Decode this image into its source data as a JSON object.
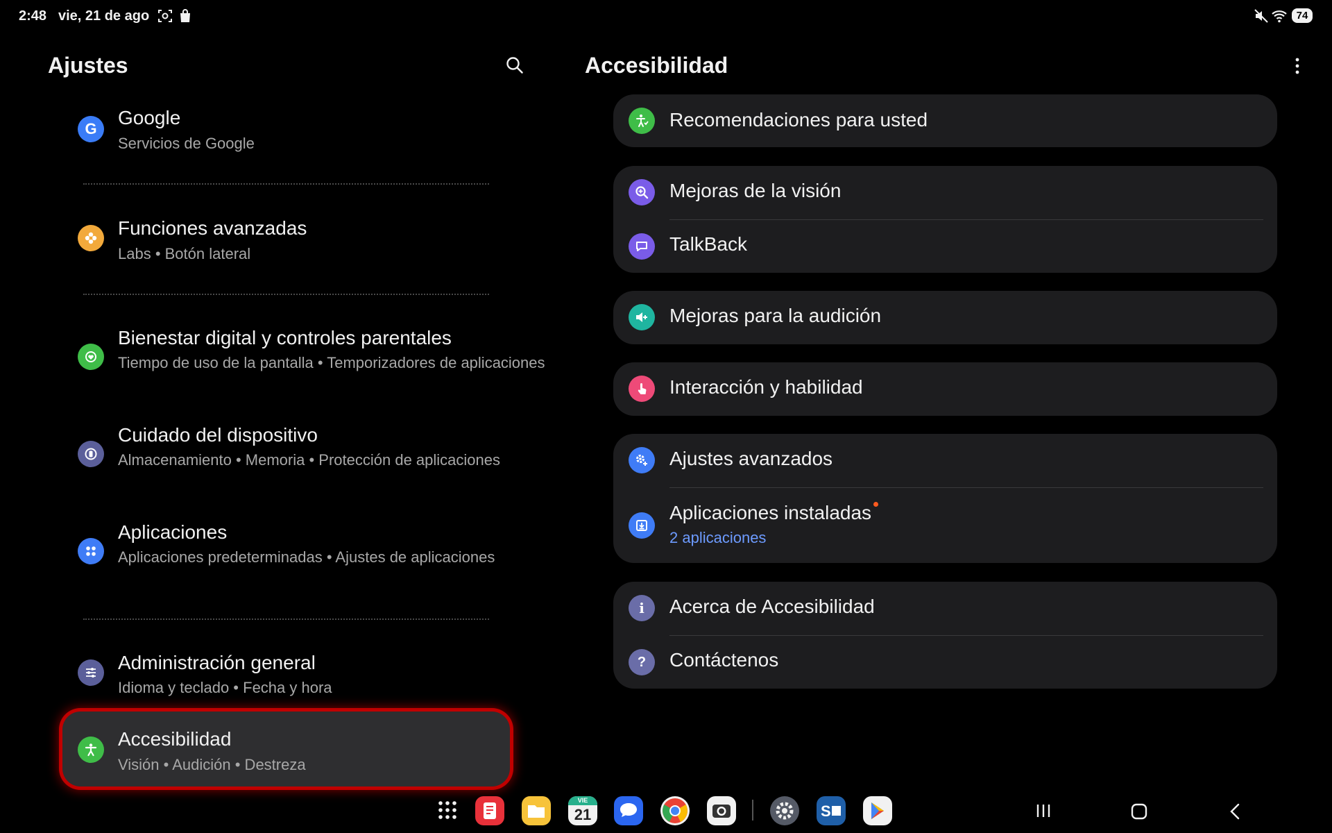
{
  "status_bar": {
    "time": "2:48",
    "date": "vie, 21 de ago",
    "battery": "74"
  },
  "left_pane": {
    "title": "Ajustes",
    "items": [
      {
        "title": "Google",
        "subtitle": "Servicios de Google",
        "icon": "google-icon",
        "color": "#3a7cf7"
      },
      {
        "title": "Funciones avanzadas",
        "subtitle": "Labs  •  Botón lateral",
        "icon": "flower-icon",
        "color": "#f2a93b"
      },
      {
        "title": "Bienestar digital y controles parentales",
        "subtitle": "Tiempo de uso de la pantalla  •  Temporizadores de aplicaciones",
        "icon": "wellbeing-icon",
        "color": "#3fbd48"
      },
      {
        "title": "Cuidado del dispositivo",
        "subtitle": "Almacenamiento  •  Memoria  •  Protección de aplicaciones",
        "icon": "device-care-icon",
        "color": "#5b5f9a"
      },
      {
        "title": "Aplicaciones",
        "subtitle": "Aplicaciones predeterminadas  •  Ajustes de aplicaciones",
        "icon": "apps-icon",
        "color": "#3f7cf6"
      },
      {
        "title": "Administración general",
        "subtitle": "Idioma y teclado  •  Fecha y hora",
        "icon": "sliders-icon",
        "color": "#5b5f9a"
      },
      {
        "title": "Accesibilidad",
        "subtitle": "Visión  •  Audición  •  Destreza",
        "icon": "accessibility-icon",
        "color": "#3fbd48"
      }
    ]
  },
  "right_pane": {
    "title": "Accesibilidad",
    "items": {
      "recomendaciones": {
        "title": "Recomendaciones para usted",
        "icon": "accessibility-recommend-icon",
        "color": "#3fbd48"
      },
      "vision": {
        "title": "Mejoras de la visión",
        "icon": "magnify-icon",
        "color": "#7a5ce8"
      },
      "talkback": {
        "title": "TalkBack",
        "icon": "talkback-icon",
        "color": "#7a5ce8"
      },
      "audicion": {
        "title": "Mejoras para la audición",
        "icon": "hearing-icon",
        "color": "#1fb5a0"
      },
      "interaccion": {
        "title": "Interacción y habilidad",
        "icon": "touch-icon",
        "color": "#ee4a78"
      },
      "avanzados": {
        "title": "Ajustes avanzados",
        "icon": "gear-plus-icon",
        "color": "#3f7cf6"
      },
      "instaladas": {
        "title": "Aplicaciones instaladas",
        "subtitle": "2 aplicaciones",
        "icon": "download-icon",
        "color": "#3f7cf6"
      },
      "acerca": {
        "title": "Acerca de Accesibilidad",
        "icon": "info-icon",
        "color": "#6a6da8"
      },
      "contacto": {
        "title": "Contáctenos",
        "icon": "help-icon",
        "color": "#6a6da8"
      }
    }
  },
  "dock": {
    "calendar_day_label": "VIE",
    "calendar_day": "21",
    "icons": [
      "apps-grid-icon",
      "notes-app-icon",
      "files-app-icon",
      "calendar-app-icon",
      "messages-app-icon",
      "chrome-app-icon",
      "camera-app-icon",
      "settings-app-icon",
      "s-app-icon",
      "play-store-icon"
    ]
  }
}
